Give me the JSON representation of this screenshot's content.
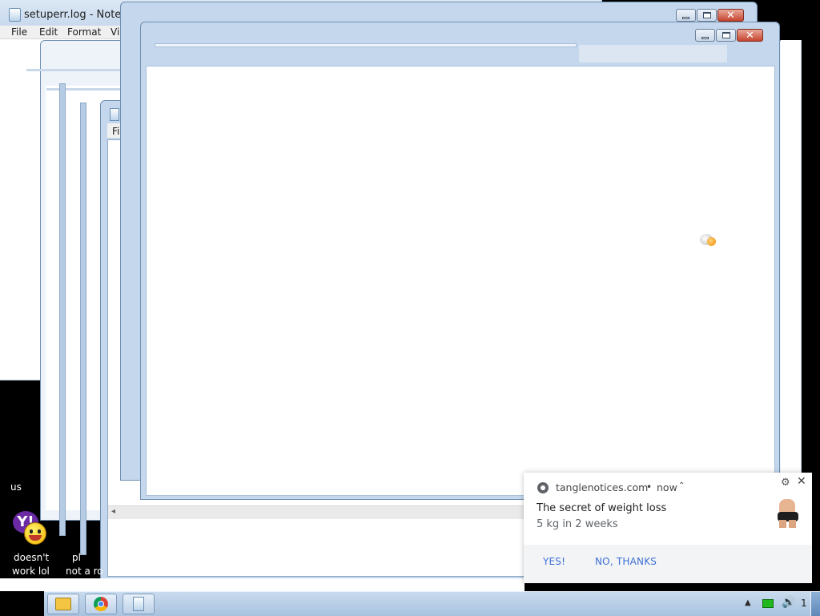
{
  "notepad": {
    "title": "setuperr.log - Notep",
    "menu": [
      "File",
      "Edit",
      "Format",
      "Vi"
    ]
  },
  "ghost_notepad": {
    "menu_fragment": "Fi"
  },
  "desktop_icons": [
    {
      "top_label": "us"
    },
    {
      "label_line1": "doesn't",
      "label_line2": "work lol",
      "icon": "yahoo-messenger-icon"
    },
    {
      "label_line1": "pl",
      "label_line2": "not a ro"
    }
  ],
  "window_controls": {
    "minimize": "minimize",
    "maximize": "maximize",
    "close": "✕"
  },
  "notification": {
    "site": "tanglenotices.com",
    "time": "now",
    "title": "The secret of weight loss",
    "message": "5 kg in 2 weeks",
    "accept_label": "YES!",
    "decline_label": "NO, THANKS",
    "accent_color": "#3d6fd6"
  },
  "taskbar": {
    "apps": [
      "windows-explorer-icon",
      "chrome-icon",
      "notepad-icon"
    ],
    "clock_fragment": "1"
  }
}
